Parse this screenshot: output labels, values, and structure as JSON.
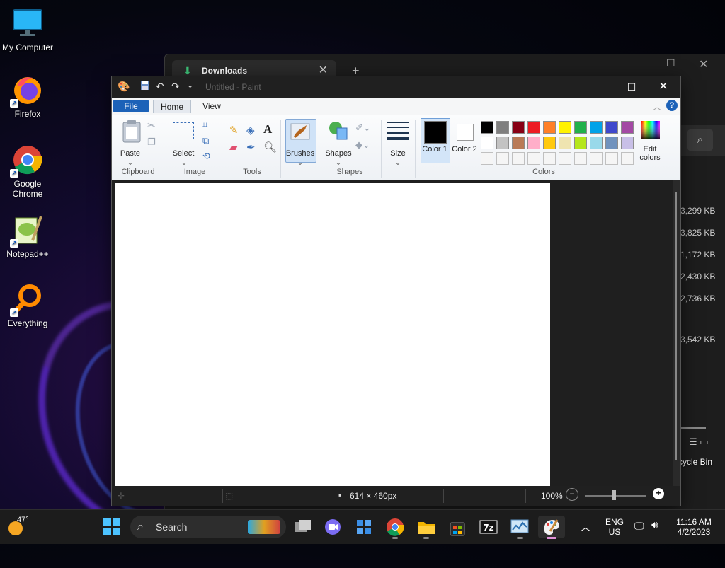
{
  "desktop": {
    "icons": [
      {
        "label": "My Computer"
      },
      {
        "label": "Firefox"
      },
      {
        "label": "Google Chrome"
      },
      {
        "label": "Notepad++"
      },
      {
        "label": "Everything"
      }
    ],
    "recycle_label": "cycle Bin"
  },
  "explorer": {
    "tab_label": "Downloads",
    "sizes": [
      "3,299 KB",
      "3,825 KB",
      "1,172 KB",
      "2,430 KB",
      "2,736 KB",
      "3,542 KB"
    ]
  },
  "paint": {
    "title": "Untitled - Paint",
    "menu": {
      "file": "File",
      "home": "Home",
      "view": "View",
      "help": "?"
    },
    "ribbon": {
      "paste": "Paste",
      "select": "Select",
      "brushes": "Brushes",
      "shapes": "Shapes",
      "size": "Size",
      "color1": "Color 1",
      "color2": "Color 2",
      "edit_colors": "Edit colors",
      "groups": {
        "clipboard": "Clipboard",
        "image": "Image",
        "tools": "Tools",
        "shapes": "Shapes",
        "colors": "Colors"
      }
    },
    "palette_row1": [
      "#000000",
      "#7f7f7f",
      "#880015",
      "#ed1c24",
      "#ff7f27",
      "#fff200",
      "#22b14c",
      "#00a2e8",
      "#3f48cc",
      "#a349a4"
    ],
    "palette_row2": [
      "#ffffff",
      "#c3c3c3",
      "#b97a57",
      "#ffaec9",
      "#ffc90e",
      "#efe4b0",
      "#b5e61d",
      "#99d9ea",
      "#7092be",
      "#c8bfe7"
    ],
    "status": {
      "dimensions": "614 × 460px",
      "zoom": "100%"
    }
  },
  "taskbar": {
    "weather": "47°",
    "search_label": "Search",
    "lang_top": "ENG",
    "lang_bottom": "US",
    "time": "11:16 AM",
    "date": "4/2/2023"
  }
}
